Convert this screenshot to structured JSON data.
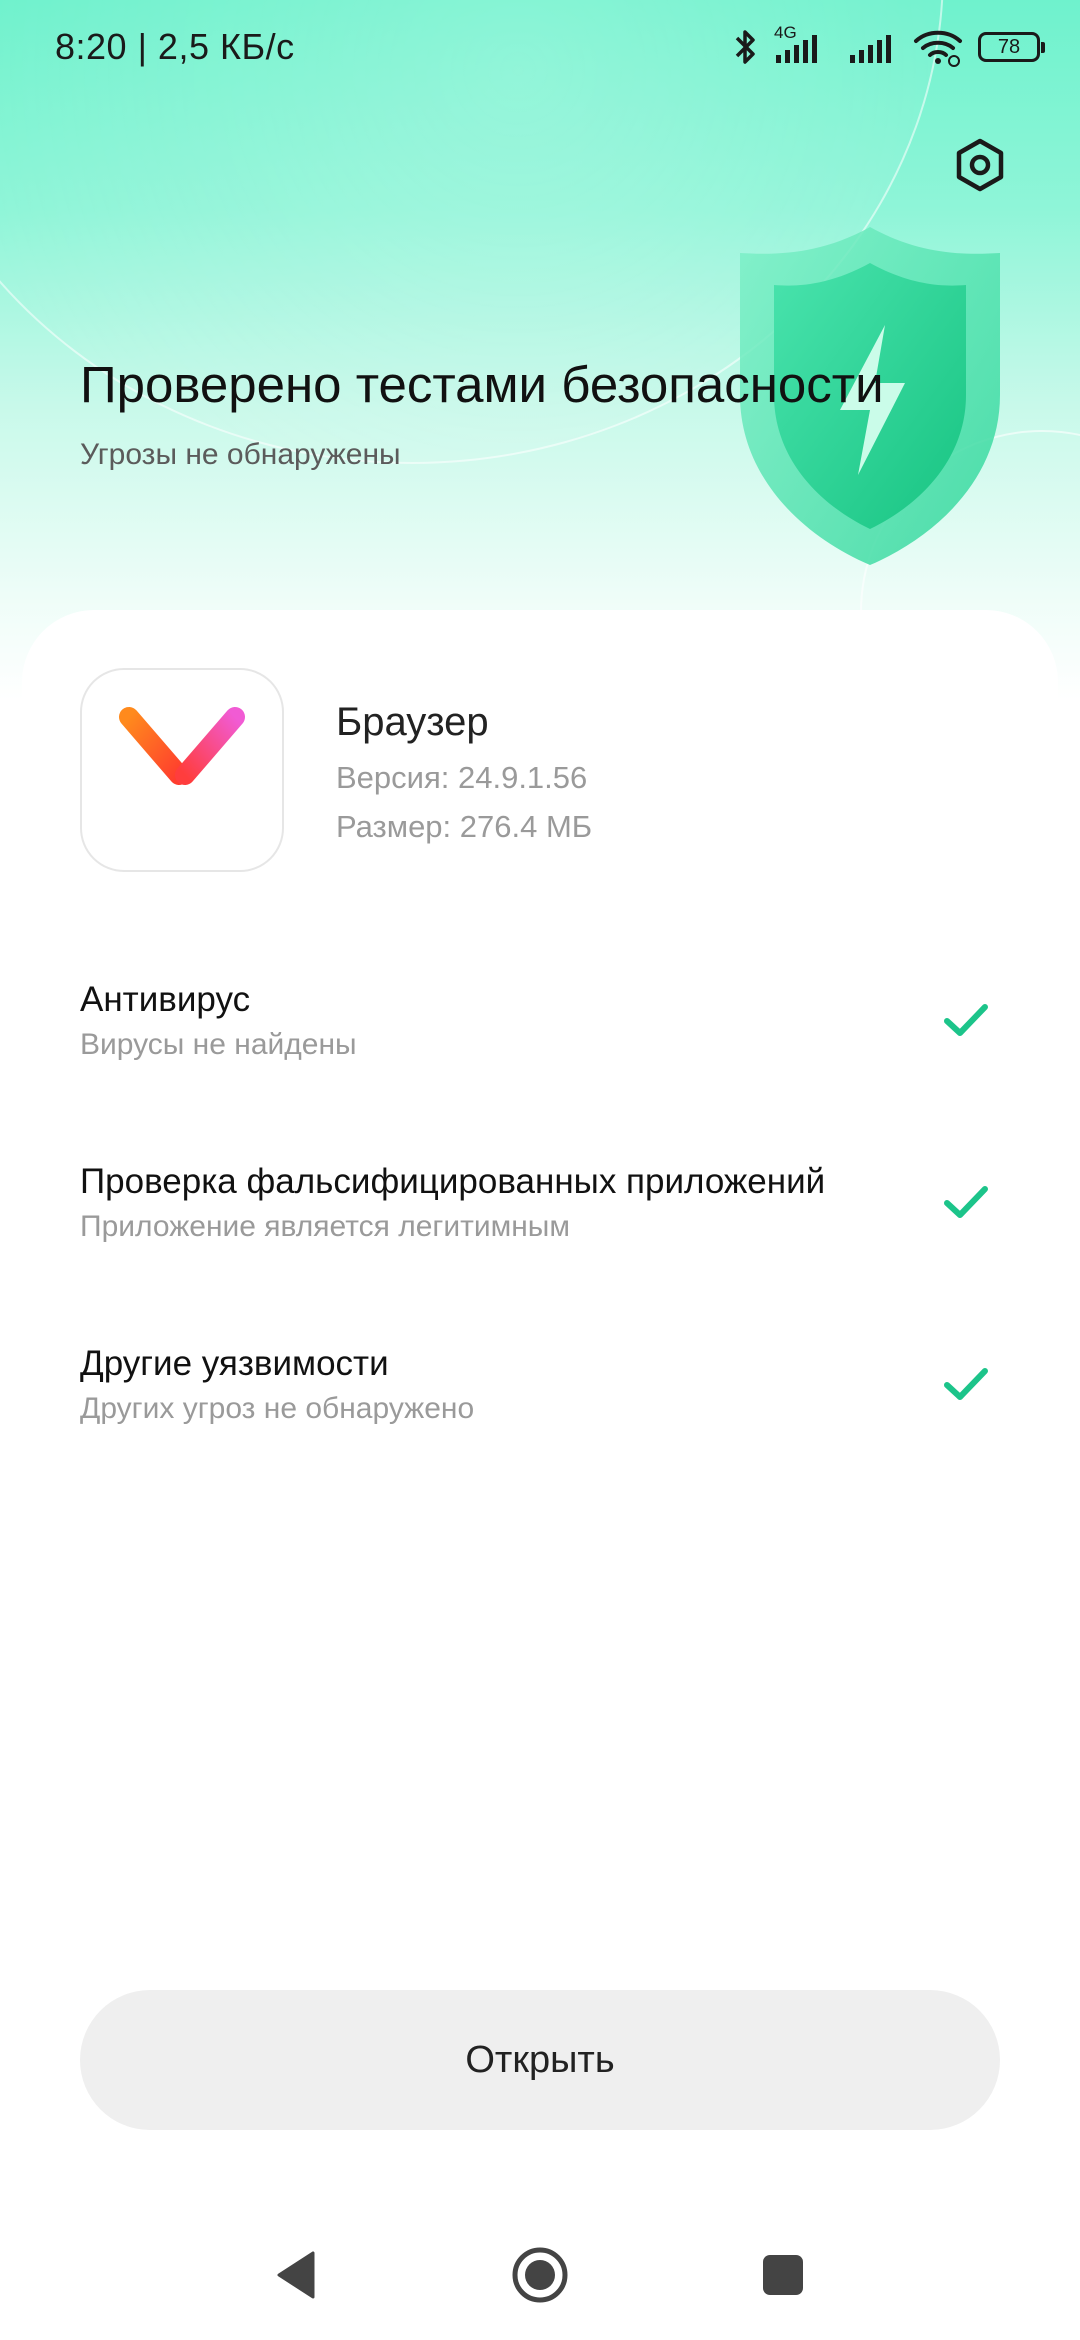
{
  "status_bar": {
    "time": "8:20 | 2,5 КБ/с",
    "network_type": "4G",
    "battery_level": "78",
    "icons": [
      "bluetooth-icon",
      "signal-4g-icon",
      "signal-icon",
      "wifi-icon",
      "battery-icon"
    ]
  },
  "header": {
    "title": "Проверено тестами безопасности",
    "subtitle": "Угрозы не обнаружены",
    "settings_icon": "settings-gear-icon",
    "illustration": "shield-lightning-icon"
  },
  "app": {
    "name": "Браузер",
    "version": "Версия: 24.9.1.56",
    "size": "Размер: 276.4 МБ",
    "icon": "yandex-browser-logo"
  },
  "checks": [
    {
      "title": "Антивирус",
      "subtitle": "Вирусы не найдены",
      "status": "passed"
    },
    {
      "title": "Проверка фальсифицированных приложений",
      "subtitle": "Приложение является легитимным",
      "status": "passed"
    },
    {
      "title": "Другие уязвимости",
      "subtitle": "Других угроз не обнаружено",
      "status": "passed"
    }
  ],
  "actions": {
    "open_label": "Открыть"
  },
  "colors": {
    "accent_green": "#1cc48a",
    "hero_gradient_top": "#6ff2cd",
    "button_bg": "#efefef"
  },
  "nav_bar": {
    "items": [
      "back-icon",
      "home-icon",
      "recents-icon"
    ]
  }
}
